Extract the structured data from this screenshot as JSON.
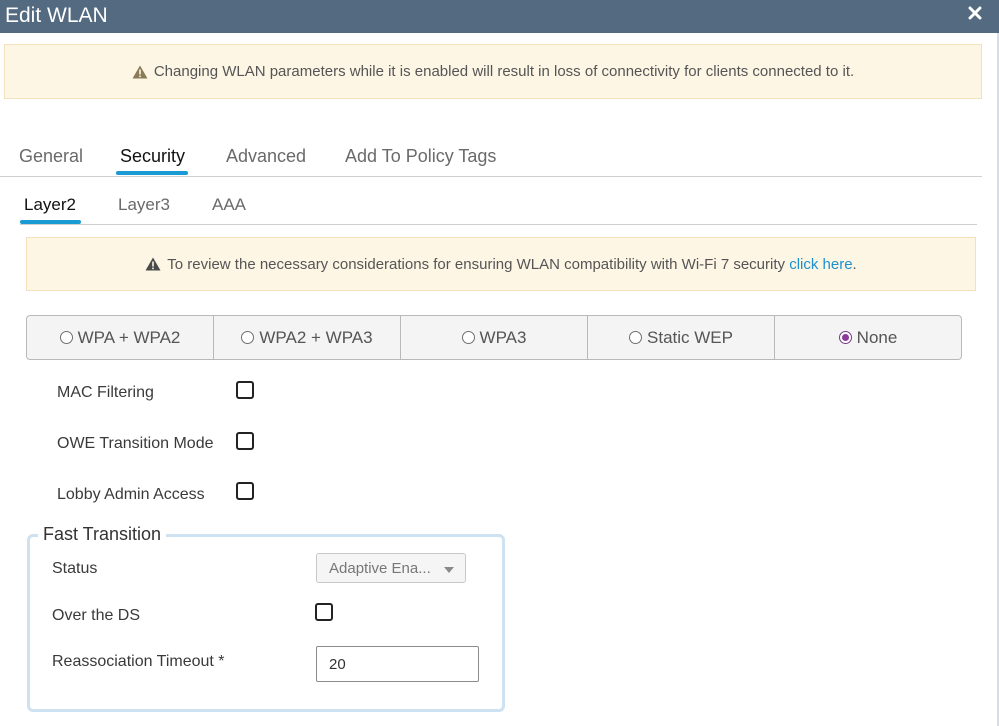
{
  "window": {
    "title": "Edit WLAN"
  },
  "top_alert": {
    "text": "Changing WLAN parameters while it is enabled will result in loss of connectivity for clients connected to it."
  },
  "tabs": [
    {
      "label": "General"
    },
    {
      "label": "Security"
    },
    {
      "label": "Advanced"
    },
    {
      "label": "Add To Policy Tags"
    }
  ],
  "active_tab": "Security",
  "subtabs": [
    {
      "label": "Layer2"
    },
    {
      "label": "Layer3"
    },
    {
      "label": "AAA"
    }
  ],
  "active_subtab": "Layer2",
  "wifi7_alert": {
    "text": "To review the necessary considerations for ensuring WLAN compatibility with Wi-Fi 7 security ",
    "link": "click here",
    "suffix": "."
  },
  "security_modes": [
    {
      "label": "WPA + WPA2",
      "selected": false
    },
    {
      "label": "WPA2 + WPA3",
      "selected": false
    },
    {
      "label": "WPA3",
      "selected": false
    },
    {
      "label": "Static WEP",
      "selected": false
    },
    {
      "label": "None",
      "selected": true
    }
  ],
  "options": {
    "mac_filtering": {
      "label": "MAC Filtering",
      "checked": false
    },
    "owe_transition": {
      "label": "OWE Transition Mode",
      "checked": false
    },
    "lobby_admin": {
      "label": "Lobby Admin Access",
      "checked": false
    }
  },
  "fast_transition": {
    "legend": "Fast Transition",
    "status_label": "Status",
    "status_value": "Adaptive Ena...",
    "over_ds_label": "Over the DS",
    "over_ds_checked": false,
    "reassoc_label": "Reassociation Timeout *",
    "reassoc_value": "20"
  },
  "colors": {
    "titlebar": "#536a80",
    "accent": "#1a9bd4",
    "alert_bg": "#fdf6e5",
    "radio_selected": "#8b3a99",
    "link": "#1b92cf"
  }
}
